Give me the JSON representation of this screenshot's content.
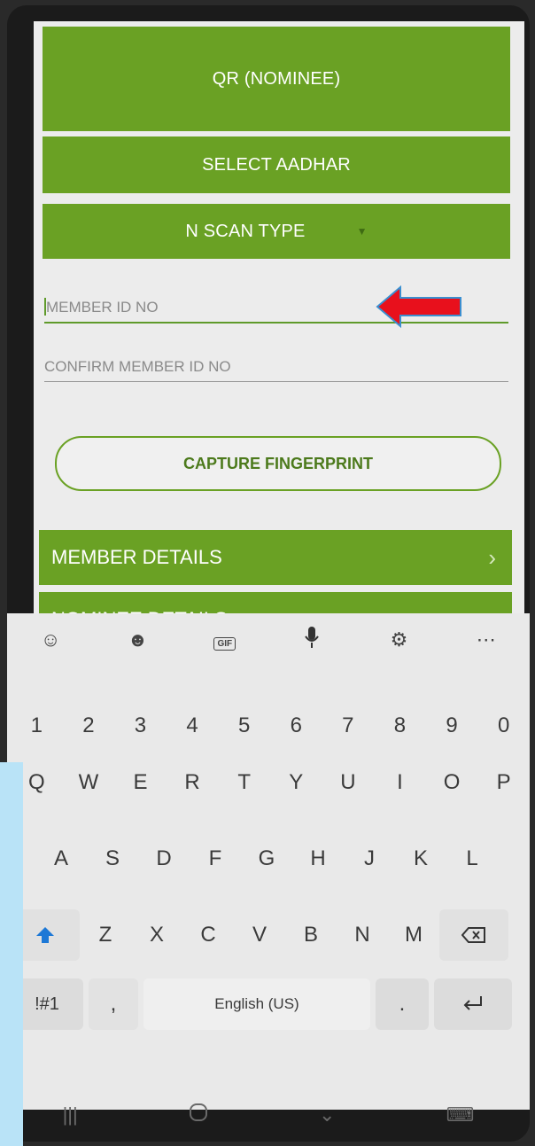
{
  "app": {
    "qr_nominee_label": "QR (NOMINEE)",
    "select_aadhar_label": "SELECT AADHAR",
    "scan_type_label": "N SCAN TYPE",
    "member_id_placeholder": "MEMBER ID NO",
    "confirm_member_id_placeholder": "CONFIRM MEMBER ID NO",
    "capture_fingerprint_label": "CAPTURE FINGERPRINT",
    "member_details_label": "MEMBER DETAILS",
    "nominee_details_label": "NOMINEE DETAILS"
  },
  "keyboard": {
    "numbers": [
      "1",
      "2",
      "3",
      "4",
      "5",
      "6",
      "7",
      "8",
      "9",
      "0"
    ],
    "row_qwerty": [
      "Q",
      "W",
      "E",
      "R",
      "T",
      "Y",
      "U",
      "I",
      "O",
      "P"
    ],
    "row_asdf": [
      "A",
      "S",
      "D",
      "F",
      "G",
      "H",
      "J",
      "K",
      "L"
    ],
    "row_zxcv": [
      "Z",
      "X",
      "C",
      "V",
      "B",
      "N",
      "M"
    ],
    "symbols_label": "!#1",
    "comma_label": ",",
    "space_label": "English (US)",
    "period_label": ".",
    "gif_label": "GIF"
  },
  "colors": {
    "accent_green": "#6aa124",
    "annotation_arrow": "#e8101c"
  },
  "icons": [
    "emoji-icon",
    "sticker-icon",
    "gif-icon",
    "mic-icon",
    "settings-icon",
    "more-icon",
    "shift-icon",
    "backspace-icon",
    "enter-icon",
    "recents-icon",
    "home-icon",
    "back-icon",
    "keyboard-icon"
  ]
}
